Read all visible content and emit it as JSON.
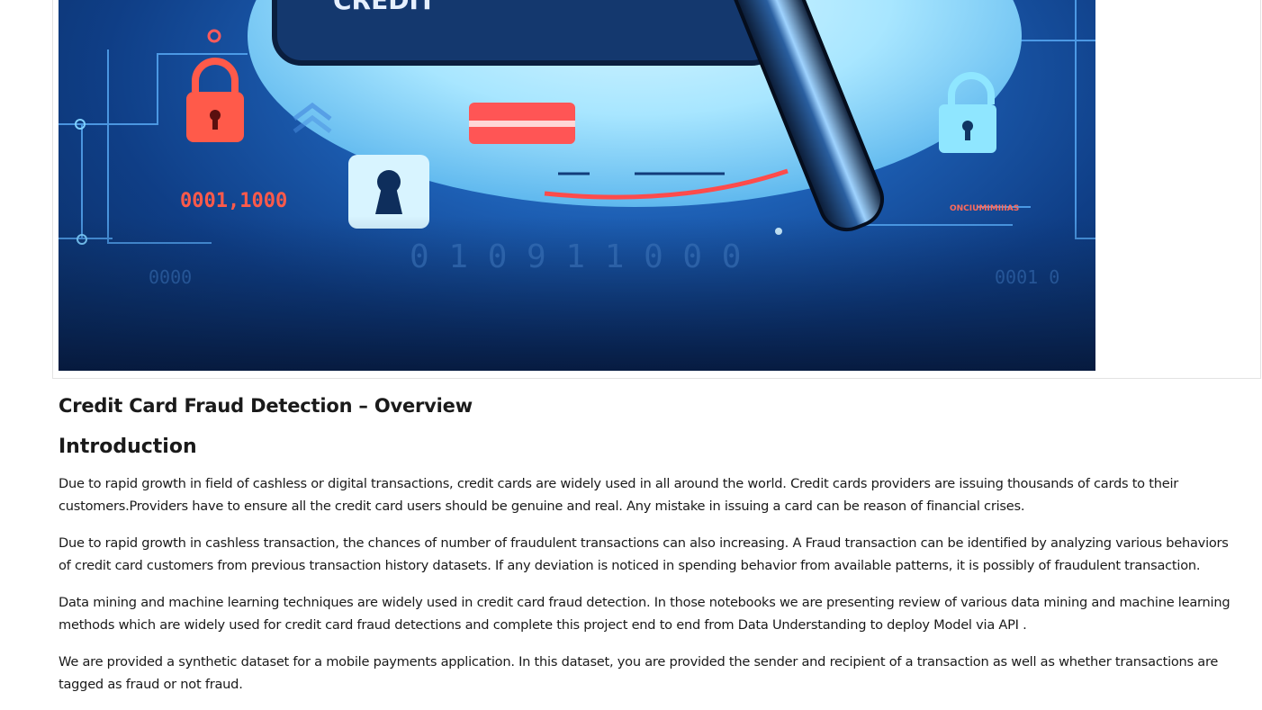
{
  "hero": {
    "digits_left": "0001,1000",
    "digits_bottom": "0 1 0 9 1 1 0 0 0",
    "digits_small_left": "0000",
    "digits_small_right": "0001 0",
    "digits_right_tag": "ONCIUMIMIIIAS",
    "card_text": "CREDIT"
  },
  "article": {
    "title": "Credit Card Fraud Detection – Overview",
    "section_heading": "Introduction",
    "paragraphs": [
      "Due to rapid growth in field of cashless or digital transactions, credit cards are widely used in all around the world. Credit cards providers are issuing thousands of cards to their customers.Providers have to ensure all the credit card users should be genuine and real. Any mistake in issuing a card can be reason of financial crises.",
      "Due to rapid growth in cashless transaction, the chances of number of fraudulent transactions can also increasing. A Fraud transaction can be identified by analyzing various behaviors of credit card customers from previous transaction history datasets. If any deviation is noticed in spending behavior from available patterns, it is possibly of fraudulent transaction.",
      "Data mining and machine learning techniques are widely used in credit card fraud detection. In those notebooks we are presenting review of various data mining and machine learning methods which are widely used for credit card fraud detections and complete this project end to end from Data Understanding to deploy Model via API .",
      "We are provided a synthetic dataset for a mobile payments application. In this dataset, you are provided the sender and recipient of a transaction as well as whether transactions are tagged as fraud or not fraud."
    ]
  }
}
